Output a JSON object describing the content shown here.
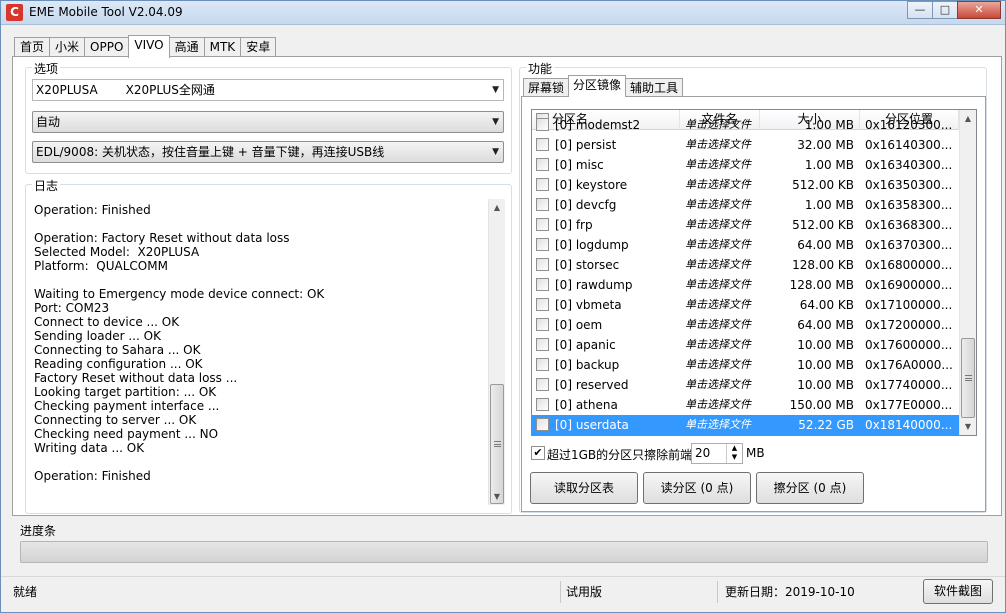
{
  "window": {
    "title": "EME Mobile Tool V2.04.09",
    "app_icon_glyph": "C",
    "buttons": [
      "—",
      "□",
      "✕"
    ]
  },
  "main_tabs": [
    "首页",
    "小米",
    "OPPO",
    "VIVO",
    "高通",
    "MTK",
    "安卓"
  ],
  "active_main_tab": "VIVO",
  "options": {
    "title": "选项",
    "model_code": "X20PLUSA",
    "model_name": "X20PLUS全网通",
    "mode": "自动",
    "edl_hint": "EDL/9008: 关机状态，按住音量上键 + 音量下键，再连接USB线"
  },
  "log": {
    "title": "日志",
    "lines": [
      "Operation: Finished",
      "",
      "Operation: Factory Reset without data loss",
      "Selected Model:  X20PLUSA",
      "Platform:  QUALCOMM",
      "",
      "Waiting to Emergency mode device connect: OK",
      "Port: COM23",
      "Connect to device ... OK",
      "Sending loader ... OK",
      "Connecting to Sahara ... OK",
      "Reading configuration ... OK",
      "Factory Reset without data loss ...",
      "Looking target partition: ... OK",
      "Checking payment interface ...",
      "Connecting to server ... OK",
      "Checking need payment ... NO",
      "Writing data ... OK",
      "",
      "Operation: Finished"
    ]
  },
  "functions": {
    "title": "功能",
    "tabs": [
      "屏幕锁",
      "分区镜像",
      "辅助工具"
    ],
    "active_tab": "分区镜像",
    "columns": [
      "分区名",
      "文件名",
      "大小",
      "分区位置"
    ],
    "partial_top_row": {
      "name": "[0] modemst2",
      "file": "单击选择文件",
      "size": "1.00 MB",
      "pos": "0x16120300..."
    },
    "rows": [
      {
        "name": "[0] persist",
        "file": "单击选择文件",
        "size": "32.00 MB",
        "pos": "0x16140300..."
      },
      {
        "name": "[0] misc",
        "file": "单击选择文件",
        "size": "1.00 MB",
        "pos": "0x16340300..."
      },
      {
        "name": "[0] keystore",
        "file": "单击选择文件",
        "size": "512.00 KB",
        "pos": "0x16350300..."
      },
      {
        "name": "[0] devcfg",
        "file": "单击选择文件",
        "size": "1.00 MB",
        "pos": "0x16358300..."
      },
      {
        "name": "[0] frp",
        "file": "单击选择文件",
        "size": "512.00 KB",
        "pos": "0x16368300..."
      },
      {
        "name": "[0] logdump",
        "file": "单击选择文件",
        "size": "64.00 MB",
        "pos": "0x16370300..."
      },
      {
        "name": "[0] storsec",
        "file": "单击选择文件",
        "size": "128.00 KB",
        "pos": "0x16800000..."
      },
      {
        "name": "[0] rawdump",
        "file": "单击选择文件",
        "size": "128.00 MB",
        "pos": "0x16900000..."
      },
      {
        "name": "[0] vbmeta",
        "file": "单击选择文件",
        "size": "64.00 KB",
        "pos": "0x17100000..."
      },
      {
        "name": "[0] oem",
        "file": "单击选择文件",
        "size": "64.00 MB",
        "pos": "0x17200000..."
      },
      {
        "name": "[0] apanic",
        "file": "单击选择文件",
        "size": "10.00 MB",
        "pos": "0x17600000..."
      },
      {
        "name": "[0] backup",
        "file": "单击选择文件",
        "size": "10.00 MB",
        "pos": "0x176A0000..."
      },
      {
        "name": "[0] reserved",
        "file": "单击选择文件",
        "size": "10.00 MB",
        "pos": "0x17740000..."
      },
      {
        "name": "[0] athena",
        "file": "单击选择文件",
        "size": "150.00 MB",
        "pos": "0x177E0000..."
      },
      {
        "name": "[0] userdata",
        "file": "单击选择文件",
        "size": "52.22 GB",
        "pos": "0x18140000..."
      }
    ],
    "selected_row": "[0] userdata",
    "erase_option_label": "超过1GB的分区只擦除前端",
    "erase_option_checked": true,
    "erase_mb_value": "20",
    "erase_mb_unit": "MB",
    "read_table_button": "读取分区表",
    "read_partition_button": "读分区 (0 点)",
    "erase_partition_button": "擦分区 (0 点)"
  },
  "progress": {
    "title": "进度条",
    "value_percent": 0
  },
  "statusbar": {
    "status": "就绪",
    "edition": "试用版",
    "update_date": "更新日期：2019-10-10",
    "screenshot_button": "软件截图"
  }
}
